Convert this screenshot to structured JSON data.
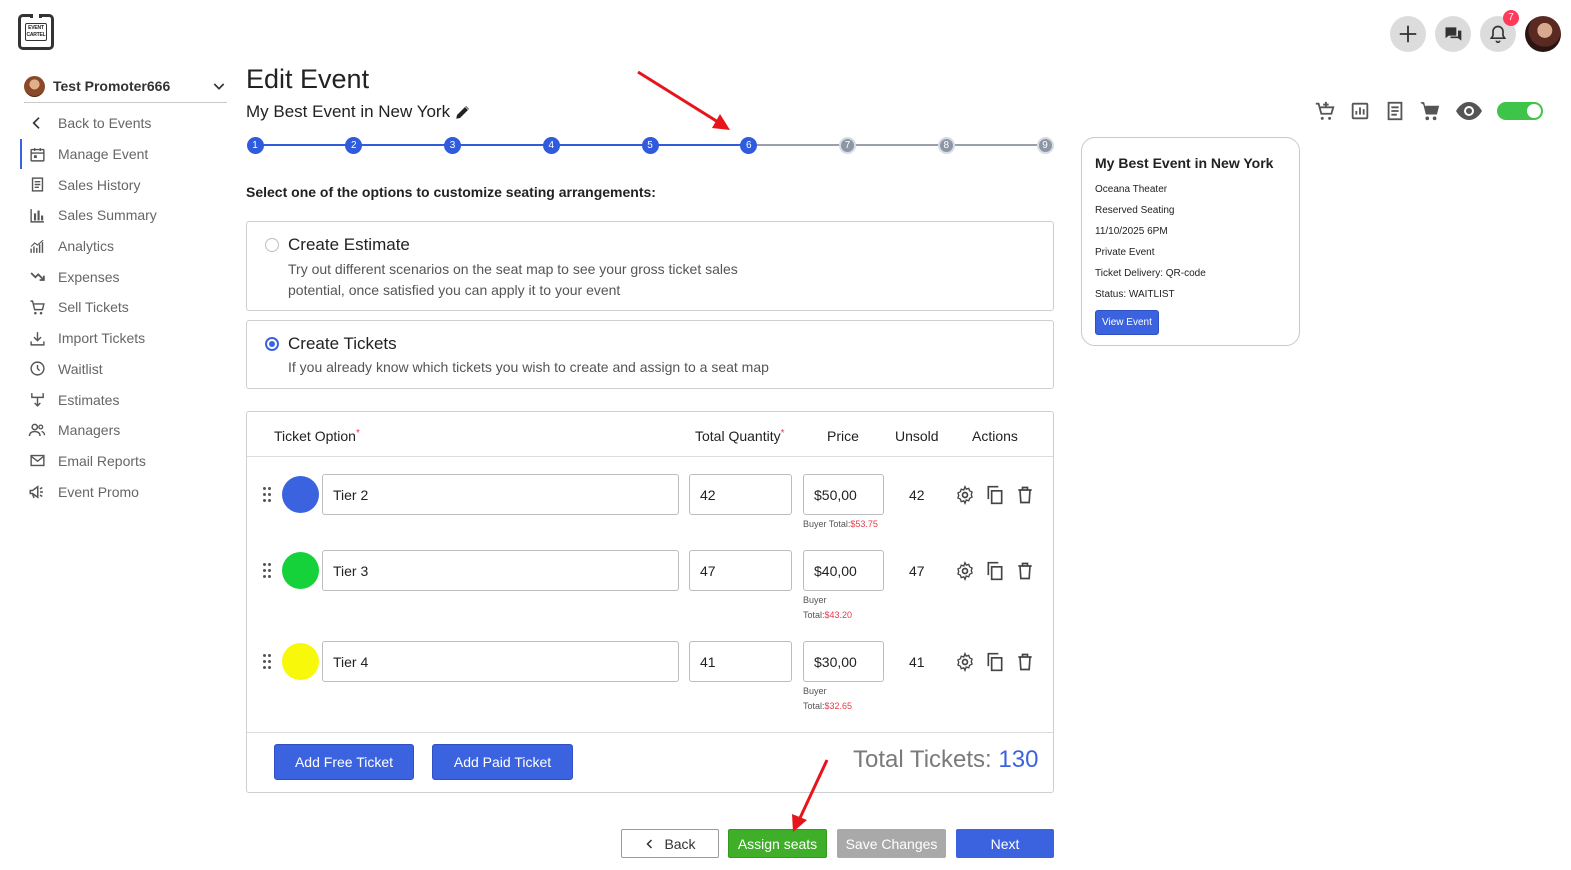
{
  "app": {
    "logo_text_line1": "EVENT",
    "logo_text_line2": "CARTEL",
    "notification_count": "7"
  },
  "sidebar": {
    "promoter_name": "Test Promoter666",
    "items": [
      {
        "label": "Back to Events",
        "icon": "chevron-left-icon"
      },
      {
        "label": "Manage Event",
        "icon": "calendar-icon"
      },
      {
        "label": "Sales History",
        "icon": "receipt-icon"
      },
      {
        "label": "Sales Summary",
        "icon": "bar-chart-icon"
      },
      {
        "label": "Analytics",
        "icon": "analytics-icon"
      },
      {
        "label": "Expenses",
        "icon": "trend-down-icon"
      },
      {
        "label": "Sell Tickets",
        "icon": "cart-icon"
      },
      {
        "label": "Import Tickets",
        "icon": "download-icon"
      },
      {
        "label": "Waitlist",
        "icon": "clock-icon"
      },
      {
        "label": "Estimates",
        "icon": "fork-icon"
      },
      {
        "label": "Managers",
        "icon": "users-icon"
      },
      {
        "label": "Email Reports",
        "icon": "mail-icon"
      },
      {
        "label": "Event Promo",
        "icon": "megaphone-icon"
      }
    ]
  },
  "header": {
    "title": "Edit Event",
    "event_name": "My Best Event in New York"
  },
  "stepper": {
    "steps": [
      "1",
      "2",
      "3",
      "4",
      "5",
      "6",
      "7",
      "8",
      "9"
    ],
    "current": 6,
    "active_color": "#2f5bdc",
    "inactive_color": "#8d96a5"
  },
  "seating": {
    "instruction": "Select one of the options to customize seating arrangements:",
    "option_estimate": {
      "title": "Create Estimate",
      "desc_line1": "Try out different scenarios on the seat map to see your gross ticket sales",
      "desc_line2": "potential, once satisfied you can apply it to your event",
      "selected": false
    },
    "option_tickets": {
      "title": "Create Tickets",
      "desc": "If you already know which tickets you wish to create and assign to a seat map",
      "selected": true
    }
  },
  "tickets": {
    "columns": {
      "option": "Ticket Option",
      "quantity": "Total Quantity",
      "price": "Price",
      "unsold": "Unsold",
      "actions": "Actions",
      "required_mark": "*"
    },
    "buyer_total_label": "Buyer Total:",
    "buyer_label": "Buyer",
    "total_label": "Total:",
    "rows": [
      {
        "name": "Tier 2",
        "color": "#3b63e0",
        "quantity": "42",
        "price": "$50,00",
        "buyer_total": "$53.75",
        "unsold": "42"
      },
      {
        "name": "Tier 3",
        "color": "#15d13a",
        "quantity": "47",
        "price": "$40,00",
        "buyer_total": "$43.20",
        "unsold": "47"
      },
      {
        "name": "Tier 4",
        "color": "#f8f80a",
        "quantity": "41",
        "price": "$30,00",
        "buyer_total": "$32.65",
        "unsold": "41"
      }
    ],
    "add_free_label": "Add Free Ticket",
    "add_paid_label": "Add Paid Ticket",
    "total_tickets_label": "Total Tickets:",
    "total_tickets_value": "130"
  },
  "footer": {
    "back_label": "Back",
    "assign_label": "Assign seats",
    "save_label": "Save Changes",
    "next_label": "Next"
  },
  "event_card": {
    "title": "My Best Event in New York",
    "venue": "Oceana Theater",
    "seating": "Reserved Seating",
    "datetime": "11/10/2025 6PM",
    "privacy": "Private Event",
    "delivery": "Ticket Delivery: QR-code",
    "status": "Status: WAITLIST",
    "view_label": "View Event"
  },
  "toolbar": {
    "icons": [
      "cart-add-icon",
      "report-icon",
      "receipt-icon",
      "cart-icon",
      "eye-icon"
    ],
    "publish_toggle_on": true
  }
}
